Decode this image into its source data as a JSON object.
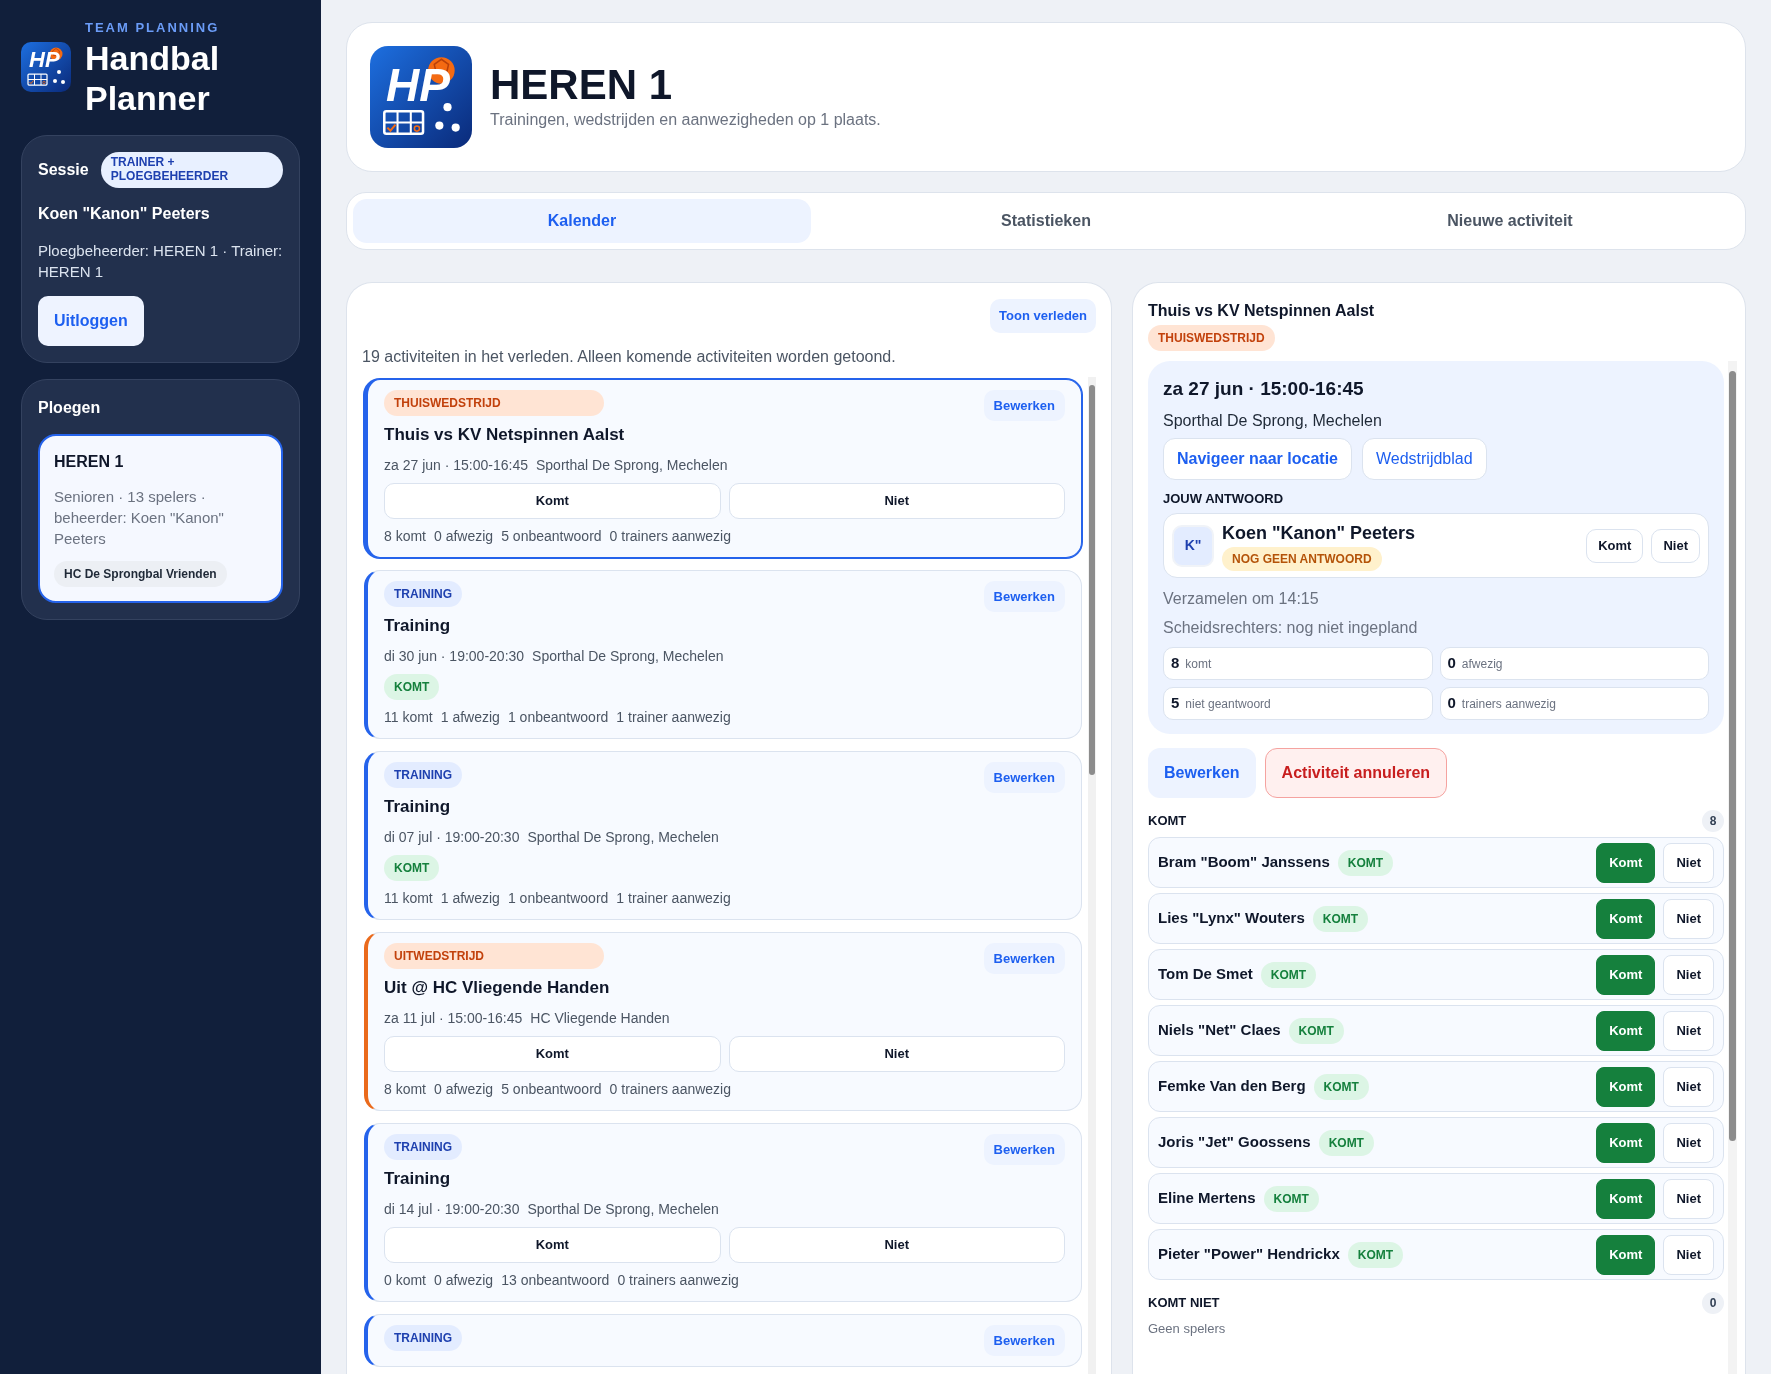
{
  "app": {
    "eyebrow": "TEAM PLANNING",
    "title": "Handbal Planner",
    "logo_text": "HP"
  },
  "session": {
    "label": "Sessie",
    "role": "TRAINER + PLOEGBEHEERDER",
    "user": "Koen \"Kanon\" Peeters",
    "roles_text": "Ploegbeheerder: HEREN 1 · Trainer: HEREN 1",
    "logout": "Uitloggen"
  },
  "teams": {
    "title": "Ploegen",
    "items": [
      {
        "name": "HEREN 1",
        "details": "Senioren · 13 spelers · beheerder: Koen \"Kanon\" Peeters",
        "club": "HC De Sprongbal Vrienden",
        "selected": true
      }
    ]
  },
  "header": {
    "logo_text": "HP",
    "title": "HEREN 1",
    "subtitle": "Trainingen, wedstrijden en aanwezigheden op 1 plaats."
  },
  "tabs": [
    {
      "label": "Kalender",
      "selected": true
    },
    {
      "label": "Statistieken",
      "selected": false
    },
    {
      "label": "Nieuwe activiteit",
      "selected": false
    }
  ],
  "calendar": {
    "show_past": "Toon verleden",
    "notice": "19 activiteiten in het verleden. Alleen komende activiteiten worden getoond.",
    "activities": [
      {
        "kind": "home",
        "tag": "THUISWEDSTRIJD",
        "title": "Thuis vs KV Netspinnen Aalst",
        "when": "za 27 jun · 15:00-16:45",
        "where": "Sporthal De Sprong, Mechelen",
        "edit": "Bewerken",
        "selected": true,
        "buttons": [
          "Komt",
          "Niet"
        ],
        "stats": [
          "8 komt",
          "0 afwezig",
          "5 onbeantwoord",
          "0 trainers aanwezig"
        ]
      },
      {
        "kind": "training",
        "tag": "TRAINING",
        "title": "Training",
        "when": "di 30 jun · 19:00-20:30",
        "where": "Sporthal De Sprong, Mechelen",
        "edit": "Bewerken",
        "selected": false,
        "response_badge": "KOMT",
        "stats": [
          "11 komt",
          "1 afwezig",
          "1 onbeantwoord",
          "1 trainer aanwezig"
        ]
      },
      {
        "kind": "training",
        "tag": "TRAINING",
        "title": "Training",
        "when": "di 07 jul · 19:00-20:30",
        "where": "Sporthal De Sprong, Mechelen",
        "edit": "Bewerken",
        "selected": false,
        "response_badge": "KOMT",
        "stats": [
          "11 komt",
          "1 afwezig",
          "1 onbeantwoord",
          "1 trainer aanwezig"
        ]
      },
      {
        "kind": "away",
        "tag": "UITWEDSTRIJD",
        "title": "Uit @ HC Vliegende Handen",
        "when": "za 11 jul · 15:00-16:45",
        "where": "HC Vliegende Handen",
        "edit": "Bewerken",
        "selected": false,
        "buttons": [
          "Komt",
          "Niet"
        ],
        "stats": [
          "8 komt",
          "0 afwezig",
          "5 onbeantwoord",
          "0 trainers aanwezig"
        ]
      },
      {
        "kind": "training",
        "tag": "TRAINING",
        "title": "Training",
        "when": "di 14 jul · 19:00-20:30",
        "where": "Sporthal De Sprong, Mechelen",
        "edit": "Bewerken",
        "selected": false,
        "buttons": [
          "Komt",
          "Niet"
        ],
        "stats": [
          "0 komt",
          "0 afwezig",
          "13 onbeantwoord",
          "0 trainers aanwezig"
        ]
      },
      {
        "kind": "training",
        "tag": "TRAINING",
        "edit": "Bewerken",
        "selected": false
      }
    ]
  },
  "detail": {
    "title": "Thuis vs KV Netspinnen Aalst",
    "kind": "home",
    "tag": "THUISWEDSTRIJD",
    "date": "za 27 jun · 15:00-16:45",
    "location": "Sporthal De Sprong, Mechelen",
    "nav_button": "Navigeer naar locatie",
    "sheet_button": "Wedstrijdblad",
    "answer_label": "JOUW ANTWOORD",
    "me": {
      "initials": "K\"",
      "name": "Koen \"Kanon\" Peeters",
      "status": "NOG GEEN ANTWOORD",
      "buttons": [
        {
          "label": "Komt",
          "selected": false
        },
        {
          "label": "Niet",
          "selected": false
        }
      ]
    },
    "gather": "Verzamelen om 14:15",
    "referees": "Scheidsrechters: nog niet ingepland",
    "stats": [
      {
        "value": "8",
        "label": "komt"
      },
      {
        "value": "0",
        "label": "afwezig"
      },
      {
        "value": "5",
        "label": "niet geantwoord"
      },
      {
        "value": "0",
        "label": "trainers aanwezig"
      }
    ],
    "edit": "Bewerken",
    "cancel": "Activiteit annuleren",
    "groups": [
      {
        "title": "KOMT",
        "count": "8",
        "players": [
          {
            "name": "Bram \"Boom\" Janssens",
            "badge": "KOMT",
            "buttons": [
              {
                "label": "Komt",
                "selected": true
              },
              {
                "label": "Niet",
                "selected": false
              }
            ]
          },
          {
            "name": "Lies \"Lynx\" Wouters",
            "badge": "KOMT",
            "buttons": [
              {
                "label": "Komt",
                "selected": true
              },
              {
                "label": "Niet",
                "selected": false
              }
            ]
          },
          {
            "name": "Tom De Smet",
            "badge": "KOMT",
            "buttons": [
              {
                "label": "Komt",
                "selected": true
              },
              {
                "label": "Niet",
                "selected": false
              }
            ]
          },
          {
            "name": "Niels \"Net\" Claes",
            "badge": "KOMT",
            "buttons": [
              {
                "label": "Komt",
                "selected": true
              },
              {
                "label": "Niet",
                "selected": false
              }
            ]
          },
          {
            "name": "Femke Van den Berg",
            "badge": "KOMT",
            "buttons": [
              {
                "label": "Komt",
                "selected": true
              },
              {
                "label": "Niet",
                "selected": false
              }
            ]
          },
          {
            "name": "Joris \"Jet\" Goossens",
            "badge": "KOMT",
            "buttons": [
              {
                "label": "Komt",
                "selected": true
              },
              {
                "label": "Niet",
                "selected": false
              }
            ]
          },
          {
            "name": "Eline Mertens",
            "badge": "KOMT",
            "buttons": [
              {
                "label": "Komt",
                "selected": true
              },
              {
                "label": "Niet",
                "selected": false
              }
            ]
          },
          {
            "name": "Pieter \"Power\" Hendrickx",
            "badge": "KOMT",
            "buttons": [
              {
                "label": "Komt",
                "selected": true
              },
              {
                "label": "Niet",
                "selected": false
              }
            ]
          }
        ]
      },
      {
        "title": "KOMT NIET",
        "count": "0",
        "empty": "Geen spelers"
      }
    ]
  }
}
